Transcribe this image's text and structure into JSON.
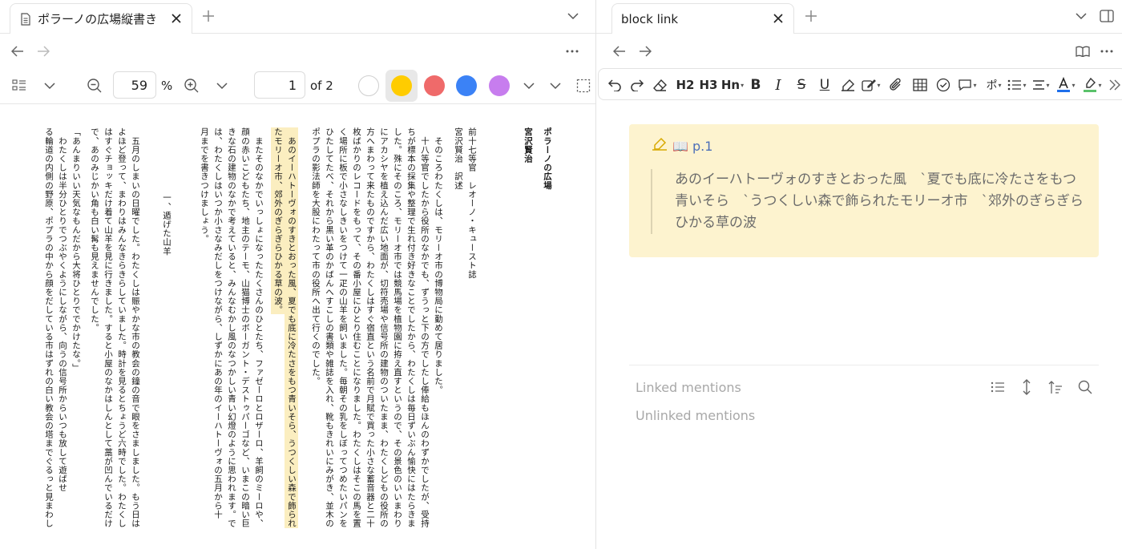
{
  "left_pane": {
    "tab": {
      "title": "ポラーノの広場縦書き",
      "icon": "document-icon"
    },
    "toolbar": {
      "zoom_value": "59",
      "zoom_unit": "%",
      "page_value": "1",
      "page_total": "of 2",
      "highlight_colors": [
        "#ffffff",
        "#ffcc00",
        "#ef6a6a",
        "#3b82f6",
        "#c77dee"
      ],
      "selected_color": "#ffcc00"
    },
    "pdf": {
      "columns": [
        {
          "text": "ポラーノの広場",
          "bold": true
        },
        {
          "text": "宮沢賢治",
          "bold": true
        },
        {
          "text": "前十七等官　レオーノ・キュースト誌"
        },
        {
          "text": "宮沢賢治　訳述"
        },
        {
          "text": "　そのころわたくしは、モリーオ市の博物局に勤めて居りました。"
        },
        {
          "text": "　十八等官でしたから役所のなかでも、ずうっと下の方でしたし俸給もほんのわずかでしたが、受持"
        },
        {
          "text": "ちが標本の採集や整理で生れ付き好きなことでしたから、わたくしは毎日ずいぶん愉快にはたらきま"
        },
        {
          "text": "した。殊にそのころ、モリーオ市では競馬場を植物園に拵え直すというので、その景色のいいまわり"
        },
        {
          "text": "にアカシヤを植え込んだ広い地面が、切符売場や信号所の建物のついたまま、わたくしどもの役所の"
        },
        {
          "text": "方へまわって来たものですから、わたくしはすぐ宿直という名前で月賦で買った小さな蓄音器と二十"
        },
        {
          "text": "枚ばかりのレコードをもって、その番小屋にひとり住むことになりました。わたくしはそこの馬を置"
        },
        {
          "text": "く場所に板で小さなしきいをつけて一疋の山羊を飼いました。毎朝その乳をしぼってつめたいパンを"
        },
        {
          "text": "ひたしてたべ、それから黒い革のかばんへすこしの書類や雑誌を入れ、靴もきれいにみがき、並木の"
        },
        {
          "text": "ポプラの影法師を大股にわたって市の役所へ出て行くのでした。"
        },
        {
          "text": "　あのイーハトーヴォのすきとおった風、夏でも底に冷たさをもつ青いそら、うつくしい森で飾られ",
          "highlight": true
        },
        {
          "text": "たモリーオ市、郊外のぎらぎらひかる草の波。",
          "highlight": true
        },
        {
          "text": "　またそのなかでいっしょになったたくさんのひとたち、ファゼーロとロザーロ、羊飼のミーロや、"
        },
        {
          "text": "顔の赤いこどもたち、地主のテーモ、山猫博士のボーガント・デストゥパーゴなど、いまこの暗い巨"
        },
        {
          "text": "きな石の建物のなかで考えていると、みんなむかし風のなつかしい青い幻燈のように思われます。で"
        },
        {
          "text": "は、わたくしはいつか小さなみだしをつけながら、しずかにあの年のイーハトーヴォの五月から十"
        },
        {
          "text": "月までを書きつけましょう。"
        },
        {
          "text": "一、遁げた山羊"
        },
        {
          "text": "　五月のしまいの日曜でした。わたくしは賑やかな市の教会の鐘の音で眼をさましました。もう日は"
        },
        {
          "text": "よほど登って、まわりはみんなきらきらしていました。時計を見るとちょうど六時でした。わたくし"
        },
        {
          "text": "はすぐチョッキだけ着て山羊を見に行きました。すると小屋のなかはしんとして藁が凹んでいるだけ"
        },
        {
          "text": "で、あのみじかい角も白い髯も見えませんでした。"
        },
        {
          "text": "「あんまりいい天気なもんだから大将ひとりででかけたな。」"
        },
        {
          "text": "　わたくしは半分ひとりでつぶやくようにしながら、向うの信号所からいつも放して遊ばせ"
        },
        {
          "text": "る輪道の内側の野原、ポプラの中から顔をだしている市はずれの白い教会の塔までぐるっと見まわし"
        }
      ]
    }
  },
  "right_pane": {
    "tab": {
      "title": "block link"
    },
    "editor_toolbar": {
      "h2": "H2",
      "h3": "H3",
      "hn": "Hn",
      "bold": "B",
      "italic": "I",
      "strike": "S",
      "underline": "U",
      "text_color": "#1f6feb",
      "highlight_color": "#5ac26a"
    },
    "block": {
      "ref_label": "📖 p.1",
      "quote": "あのイーハトーヴォのすきとおった風　`夏でも底に冷たさをもつ青いそら　`うつくしい森で飾られたモリーオ市　`郊外のぎらぎらひかる草の波"
    },
    "linked_mentions": "Linked mentions",
    "unlinked_mentions": "Unlinked mentions"
  }
}
